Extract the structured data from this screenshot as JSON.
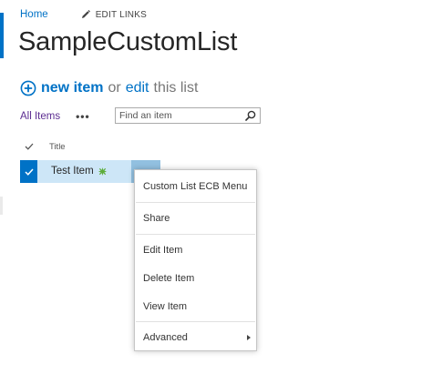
{
  "nav": {
    "home": "Home",
    "edit_links": "EDIT LINKS"
  },
  "page": {
    "title": "SampleCustomList"
  },
  "new_item": {
    "new_label": "new item",
    "or_label": "or",
    "edit_label": "edit",
    "this_list_label": "this list"
  },
  "view": {
    "all_items": "All Items",
    "more": "•••",
    "search_placeholder": "Find an item"
  },
  "list": {
    "columns": [
      "Title"
    ],
    "rows": [
      {
        "title": "Test Item",
        "selected": true,
        "is_new": true
      }
    ]
  },
  "ecb_menu": {
    "items": [
      "Custom List ECB Menu",
      "Share",
      "Edit Item",
      "Delete Item",
      "View Item",
      "Advanced"
    ]
  },
  "colors": {
    "accent": "#0072c6",
    "selected_row": "#cde6f7",
    "view_link": "#5c2d91",
    "new_badge": "#5dad3b"
  },
  "icons": {
    "edit_links": "pencil-icon",
    "new_item": "plus-circle-icon",
    "search": "search-icon",
    "check": "checkmark-icon",
    "new_badge": "new-item-badge-icon",
    "submenu": "chevron-right-icon"
  }
}
